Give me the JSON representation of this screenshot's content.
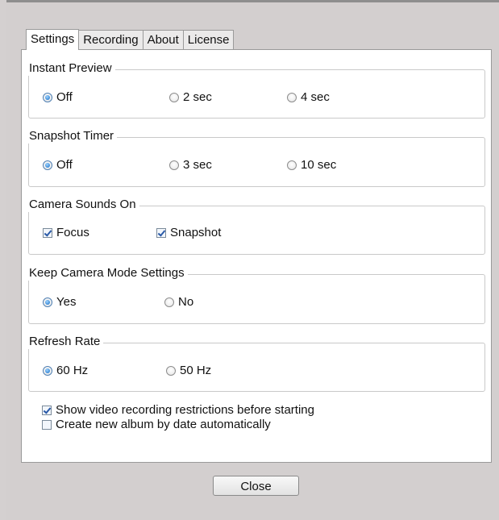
{
  "tabs": [
    "Settings",
    "Recording",
    "About",
    "License"
  ],
  "instant_preview": {
    "title": "Instant Preview",
    "options": [
      "Off",
      "2 sec",
      "4 sec"
    ],
    "selected": "Off"
  },
  "snapshot_timer": {
    "title": "Snapshot Timer",
    "options": [
      "Off",
      "3 sec",
      "10 sec"
    ],
    "selected": "Off"
  },
  "camera_sounds": {
    "title": "Camera Sounds On",
    "options": [
      "Focus",
      "Snapshot"
    ],
    "checked": [
      "Focus",
      "Snapshot"
    ]
  },
  "keep_mode": {
    "title": "Keep Camera Mode Settings",
    "options": [
      "Yes",
      "No"
    ],
    "selected": "Yes"
  },
  "refresh_rate": {
    "title": "Refresh Rate",
    "options": [
      "60 Hz",
      "50 Hz"
    ],
    "selected": "60 Hz"
  },
  "extra": [
    {
      "label": "Show video recording restrictions before starting",
      "checked": true
    },
    {
      "label": "Create new album by date automatically",
      "checked": false
    }
  ],
  "close_label": "Close"
}
